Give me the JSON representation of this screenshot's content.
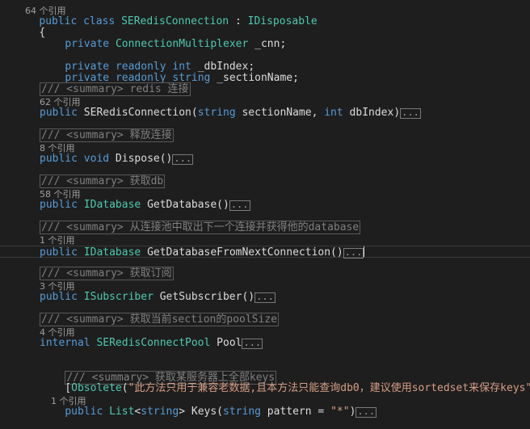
{
  "editor": {
    "lines": [
      {
        "kind": "codelens",
        "text": "64 个引用",
        "top": 0
      },
      {
        "kind": "class",
        "keyword1": "public",
        "keyword2": "class",
        "class_name": "SERedisConnection",
        "sep": " : ",
        "base": "IDisposable"
      },
      {
        "kind": "brace",
        "text": "{"
      },
      {
        "kind": "field",
        "mods": "private",
        "type": "ConnectionMultiplexer",
        "name": " _cnn;"
      },
      {
        "kind": "field2",
        "mods1": "private",
        "mods2": "readonly",
        "type": "int",
        "name": " _dbIndex;"
      },
      {
        "kind": "field2",
        "mods1": "private",
        "mods2": "readonly",
        "type": "string",
        "name": " _sectionName;"
      }
    ],
    "members": [
      {
        "summary_prefix": "///",
        "summary_tag": " <summary>",
        "summary_text": " redis 连接",
        "refs": "62 个引用",
        "sig": [
          {
            "t": "kw",
            "v": "public"
          },
          {
            "t": "pl",
            "v": " SERedisConnection("
          },
          {
            "t": "kw",
            "v": "string"
          },
          {
            "t": "pl",
            "v": " sectionName, "
          },
          {
            "t": "kw",
            "v": "int"
          },
          {
            "t": "pl",
            "v": " dbIndex)"
          }
        ]
      },
      {
        "summary_prefix": "///",
        "summary_tag": " <summary>",
        "summary_text": " 释放连接",
        "refs": "8 个引用",
        "sig": [
          {
            "t": "kw",
            "v": "public"
          },
          {
            "t": "pl",
            "v": " "
          },
          {
            "t": "kw",
            "v": "void"
          },
          {
            "t": "pl",
            "v": " Dispose()"
          }
        ]
      },
      {
        "summary_prefix": "///",
        "summary_tag": " <summary>",
        "summary_text": " 获取db",
        "refs": "58 个引用",
        "sig": [
          {
            "t": "kw",
            "v": "public"
          },
          {
            "t": "pl",
            "v": " "
          },
          {
            "t": "ty",
            "v": "IDatabase"
          },
          {
            "t": "pl",
            "v": " GetDatabase()"
          }
        ]
      },
      {
        "summary_prefix": "///",
        "summary_tag": " <summary>",
        "summary_text": " 从连接池中取出下一个连接并获得他的database",
        "refs": "1 个引用",
        "sig": [
          {
            "t": "kw",
            "v": "public"
          },
          {
            "t": "pl",
            "v": " "
          },
          {
            "t": "ty",
            "v": "IDatabase"
          },
          {
            "t": "pl",
            "v": " GetDatabaseFromNextConnection()"
          }
        ],
        "current": true
      },
      {
        "summary_prefix": "///",
        "summary_tag": " <summary>",
        "summary_text": " 获取订阅",
        "refs": "3 个引用",
        "sig": [
          {
            "t": "kw",
            "v": "public"
          },
          {
            "t": "pl",
            "v": " "
          },
          {
            "t": "ty",
            "v": "ISubscriber"
          },
          {
            "t": "pl",
            "v": " GetSubscriber()"
          }
        ]
      },
      {
        "summary_prefix": "///",
        "summary_tag": " <summary>",
        "summary_text": " 获取当前section的poolSize",
        "refs": "4 个引用",
        "sig": [
          {
            "t": "kw",
            "v": "internal"
          },
          {
            "t": "pl",
            "v": " "
          },
          {
            "t": "ty",
            "v": "SERedisConnectPool"
          },
          {
            "t": "pl",
            "v": " Pool"
          }
        ]
      }
    ],
    "last_member": {
      "summary_prefix": "///",
      "summary_tag": " <summary>",
      "summary_text": " 获取某服务器上全部keys",
      "attribute_open": "[",
      "attribute_name": "Obsolete",
      "attribute_paren": "(",
      "attribute_string": "\"此方法只用于兼容老数据,且本方法只能查询db0，建议使用sortedset来保存keys\"",
      "attribute_close": ")]",
      "refs": "1 个引用",
      "sig_public": "public",
      "sig_type": "List",
      "sig_generic_open": "<",
      "sig_generic_kw": "string",
      "sig_generic_close": ">",
      "sig_method": " Keys(",
      "sig_param_kw": "string",
      "sig_param_name": " pattern = ",
      "sig_param_default": "\"*\"",
      "sig_close": ")"
    },
    "fold_marker": "..."
  }
}
